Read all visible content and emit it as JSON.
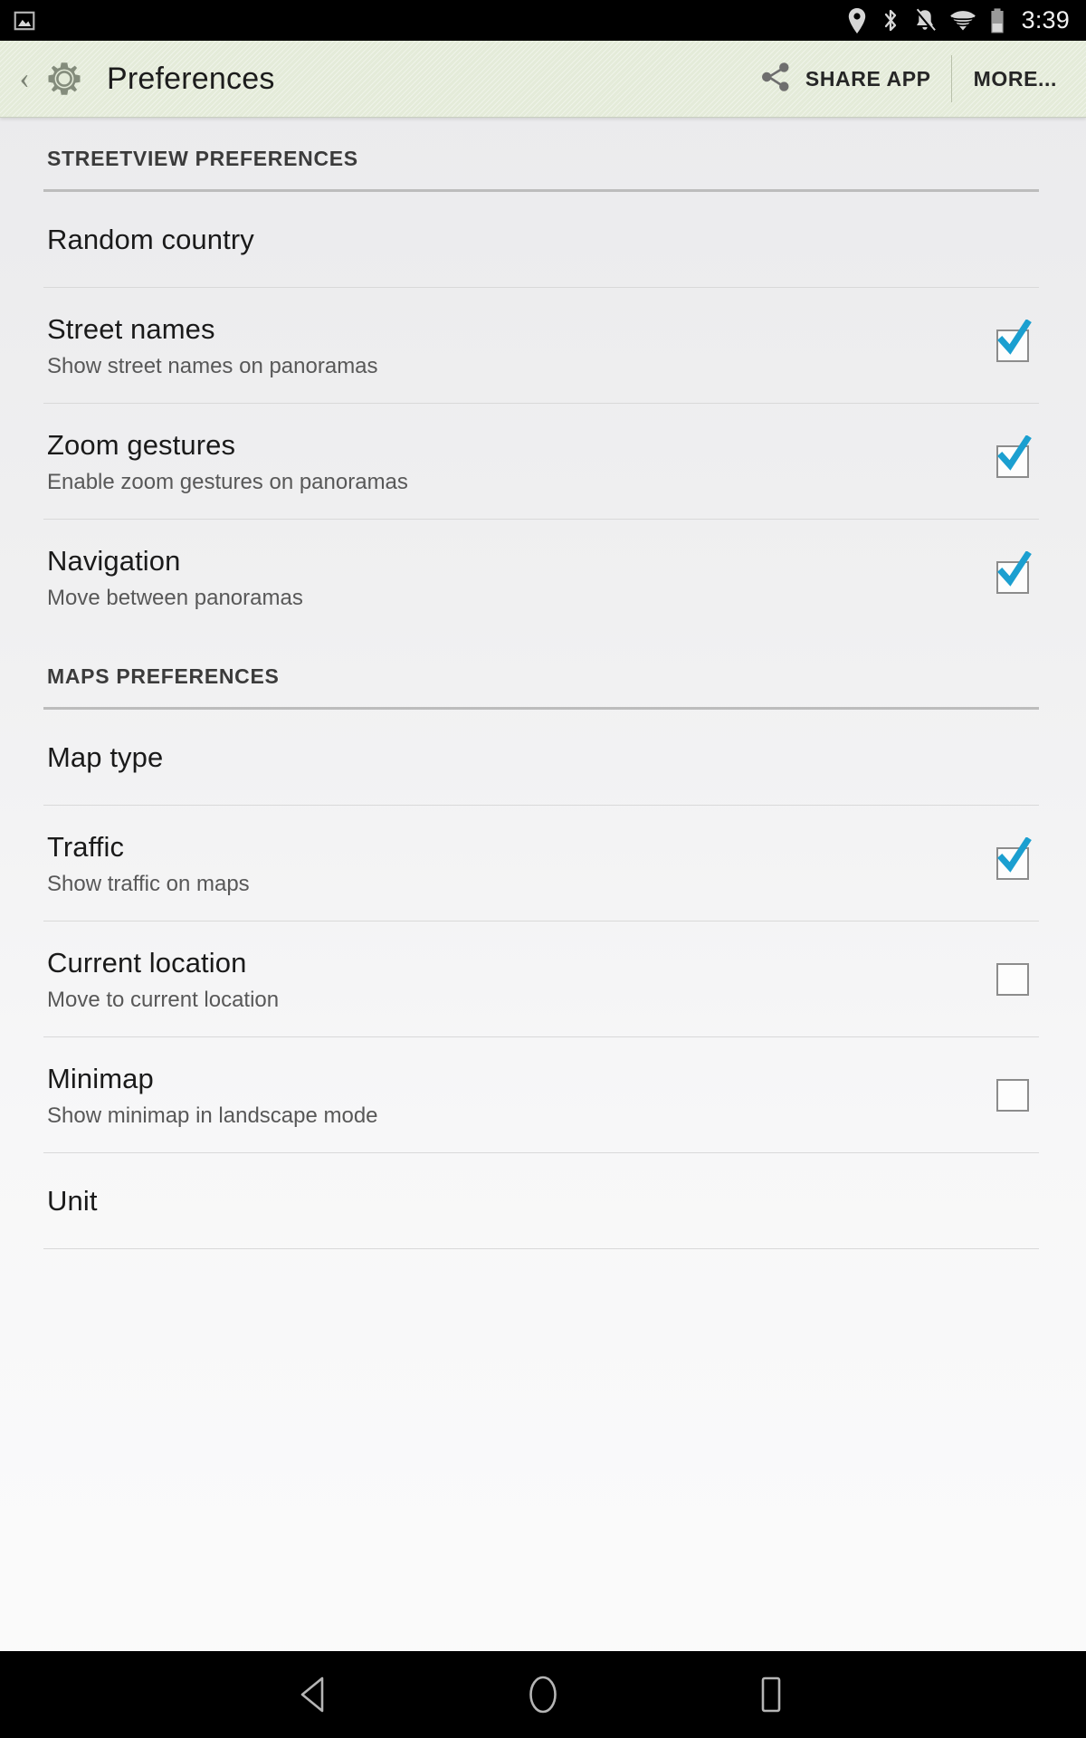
{
  "status_bar": {
    "notification_icon": "image-notification-icon",
    "icons": [
      "location-pin-icon",
      "bluetooth-icon",
      "notifications-muted-icon",
      "wifi-icon",
      "battery-icon"
    ],
    "time": "3:39"
  },
  "action_bar": {
    "up_icon": "back-chevron-icon",
    "app_icon": "gear-icon",
    "title": "Preferences",
    "share_icon": "share-icon",
    "share_label": "SHARE APP",
    "more_label": "MORE..."
  },
  "sections": [
    {
      "header": "STREETVIEW PREFERENCES",
      "items": [
        {
          "title": "Random country",
          "summary": "",
          "type": "plain",
          "checked": null
        },
        {
          "title": "Street names",
          "summary": "Show street names on panoramas",
          "type": "checkbox",
          "checked": true
        },
        {
          "title": "Zoom gestures",
          "summary": "Enable zoom gestures on panoramas",
          "type": "checkbox",
          "checked": true
        },
        {
          "title": "Navigation",
          "summary": "Move between panoramas",
          "type": "checkbox",
          "checked": true
        }
      ]
    },
    {
      "header": "MAPS PREFERENCES",
      "items": [
        {
          "title": "Map type",
          "summary": "",
          "type": "plain",
          "checked": null
        },
        {
          "title": "Traffic",
          "summary": "Show traffic on maps",
          "type": "checkbox",
          "checked": true
        },
        {
          "title": "Current location",
          "summary": "Move to current location",
          "type": "checkbox",
          "checked": false
        },
        {
          "title": "Minimap",
          "summary": "Show minimap in landscape mode",
          "type": "checkbox",
          "checked": false
        },
        {
          "title": "Unit",
          "summary": "",
          "type": "plain",
          "checked": null
        }
      ]
    }
  ],
  "nav_bar": {
    "back": "back-triangle-icon",
    "home": "home-circle-icon",
    "recents": "recents-square-icon"
  },
  "colors": {
    "action_bar_bg": "#e4ebd9",
    "checkbox_check": "#1b9fd0",
    "page_bg_top": "#eaeaec",
    "page_bg_bottom": "#fbfbfb",
    "status_bar_bg": "#000000"
  }
}
